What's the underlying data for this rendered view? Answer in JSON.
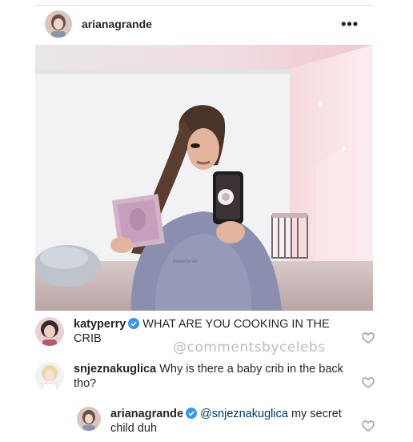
{
  "post": {
    "username": "arianagrande",
    "more_label": "•••"
  },
  "watermark": "@commentsbycelebs",
  "comments": [
    {
      "username": "katyperry",
      "verified": true,
      "text": "WHAT ARE YOU COOKING IN THE CRIB"
    },
    {
      "username": "snjeznakuglica",
      "verified": false,
      "text": "Why is there a baby crib in the back tho?"
    },
    {
      "username": "arianagrande",
      "verified": true,
      "mention": "@snjeznakuglica",
      "text": "my secret child duh"
    }
  ],
  "colors": {
    "verified_blue": "#3897f0",
    "mention_blue": "#003569",
    "text": "#262626",
    "border": "#dbdbdb"
  },
  "icons": {
    "more": "more-options-icon",
    "verified": "verified-badge-icon",
    "like": "heart-icon"
  }
}
